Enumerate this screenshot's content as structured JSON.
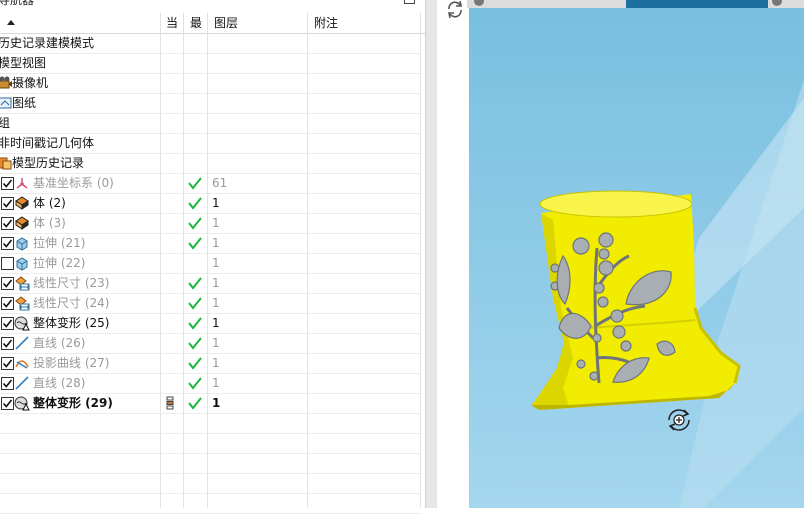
{
  "navigator": {
    "title": "导航器",
    "columns": {
      "name": "",
      "current": "当",
      "latest": "最",
      "layer": "图层",
      "note": "附注"
    },
    "top_items": [
      {
        "label": "历史记录建模模式",
        "x": 0
      },
      {
        "label": "模型视图",
        "x": 0
      },
      {
        "label": "摄像机",
        "x": 14,
        "icon": "camera-icon"
      },
      {
        "label": "图纸",
        "x": 14,
        "icon": "drawing-icon"
      },
      {
        "label": "组",
        "x": 0
      },
      {
        "label": "非时间戳记几何体",
        "x": 0
      },
      {
        "label": "模型历史记录",
        "x": 14,
        "icon": "history-icon"
      }
    ],
    "features": [
      {
        "label": "基准坐标系 (0)",
        "checked": true,
        "icon": "datum-csys-icon",
        "latest": true,
        "layer": "61",
        "style": "grey"
      },
      {
        "label": "体 (2)",
        "checked": true,
        "icon": "body-icon",
        "latest": true,
        "layer": "1",
        "style": "normal"
      },
      {
        "label": "体 (3)",
        "checked": true,
        "icon": "body-icon",
        "latest": true,
        "layer": "1",
        "style": "grey"
      },
      {
        "label": "拉伸 (21)",
        "checked": true,
        "icon": "extrude-icon",
        "latest": true,
        "layer": "1",
        "style": "grey"
      },
      {
        "label": "拉伸 (22)",
        "checked": false,
        "icon": "extrude-icon",
        "latest": false,
        "layer": "1",
        "style": "grey"
      },
      {
        "label": "线性尺寸 (23)",
        "checked": true,
        "icon": "linear-dimension-icon",
        "latest": true,
        "layer": "1",
        "style": "grey"
      },
      {
        "label": "线性尺寸 (24)",
        "checked": true,
        "icon": "linear-dimension-icon",
        "latest": true,
        "layer": "1",
        "style": "grey"
      },
      {
        "label": "整体变形 (25)",
        "checked": true,
        "icon": "global-shaping-icon",
        "latest": true,
        "layer": "1",
        "style": "normal"
      },
      {
        "label": "直线 (26)",
        "checked": true,
        "icon": "line-icon",
        "latest": true,
        "layer": "1",
        "style": "grey"
      },
      {
        "label": "投影曲线 (27)",
        "checked": true,
        "icon": "project-curve-icon",
        "latest": true,
        "layer": "1",
        "style": "grey"
      },
      {
        "label": "直线 (28)",
        "checked": true,
        "icon": "line-icon",
        "latest": true,
        "layer": "1",
        "style": "grey"
      },
      {
        "label": "整体变形 (29)",
        "checked": true,
        "icon": "global-shaping-icon",
        "latest": true,
        "layer": "1",
        "style": "bold",
        "current": true
      }
    ]
  },
  "viewport": {
    "background_color": "#8cc9e6",
    "model_color": "#f3ee00",
    "tab_active_color": "#1d6fa0"
  }
}
